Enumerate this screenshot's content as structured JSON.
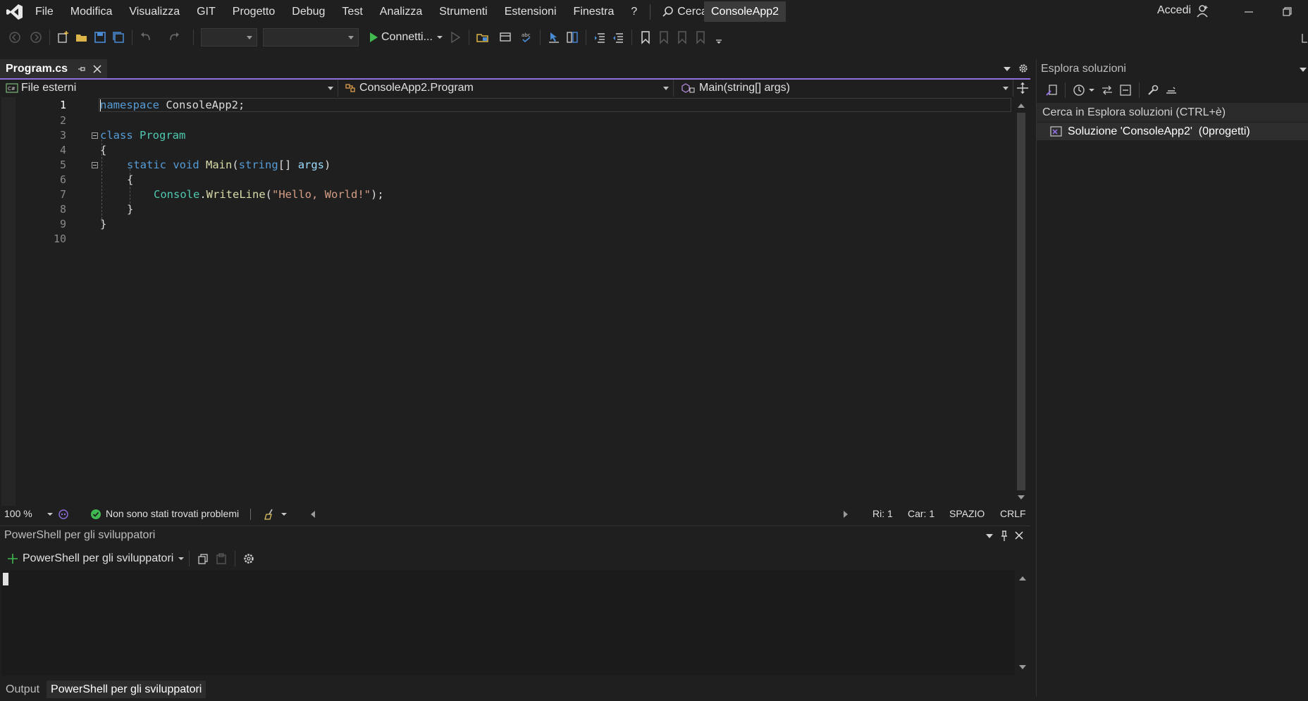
{
  "menu": {
    "items": [
      "File",
      "Modifica",
      "Visualizza",
      "GIT",
      "Progetto",
      "Debug",
      "Test",
      "Analizza",
      "Strumenti",
      "Estensioni",
      "Finestra",
      "?"
    ],
    "search_label": "Cerca",
    "solution_name": "ConsoleApp2",
    "sign_in": "Accedi"
  },
  "toolbar": {
    "run_label": "Connetti..."
  },
  "editor": {
    "tab_title": "Program.cs",
    "nav_project": "File esterni",
    "nav_type": "ConsoleApp2.Program",
    "nav_member": "Main(string[] args)",
    "line_numbers": [
      "1",
      "2",
      "3",
      "4",
      "5",
      "6",
      "7",
      "8",
      "9",
      "10"
    ],
    "code": {
      "l1_kw": "namespace",
      "l1_name": " ConsoleApp2;",
      "l3_kw": "class",
      "l3_name": "Program",
      "l4": "{",
      "l5_static": "static",
      "l5_void": "void",
      "l5_main": "Main",
      "l5_open": "(",
      "l5_string": "string",
      "l5_arr": "[] ",
      "l5_args": "args",
      "l5_close": ")",
      "l6": "{",
      "l7_console": "Console",
      "l7_dot": ".",
      "l7_writeline": "WriteLine",
      "l7_open": "(",
      "l7_str": "\"Hello, World!\"",
      "l7_close": ");",
      "l8": "}",
      "l9": "}"
    }
  },
  "status": {
    "zoom": "100 %",
    "problems": "Non sono stati trovati problemi",
    "line": "Ri: 1",
    "col": "Car: 1",
    "indent": "SPAZIO",
    "eol": "CRLF"
  },
  "bottom_panel": {
    "title": "PowerShell per gli sviluppatori",
    "shell_label": "PowerShell per gli sviluppatori",
    "tabs": [
      "Output",
      "PowerShell per gli sviluppatori"
    ]
  },
  "solution_explorer": {
    "title": "Esplora soluzioni",
    "search_placeholder": "Cerca in Esplora soluzioni (CTRL+è)",
    "solution_item": "Soluzione 'ConsoleApp2'  (0progetti)"
  },
  "colors": {
    "accent": "#8f6fe0",
    "keyword": "#569cd6",
    "type": "#4ec9b0",
    "method": "#dcdcaa",
    "parameter": "#9cdcfe",
    "string": "#d69d85",
    "success": "#3fb950",
    "run": "#3fb950"
  },
  "icons": {
    "logo": "visual-studio-logo-icon",
    "status_ok": "check-circle-icon",
    "run": "play-icon"
  }
}
